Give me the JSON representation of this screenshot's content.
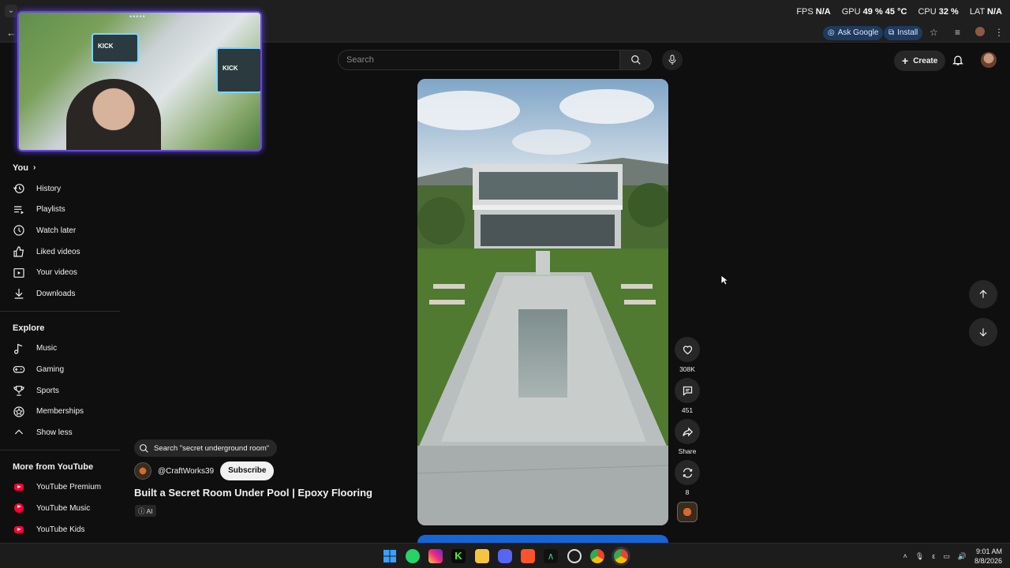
{
  "browser": {
    "stats": {
      "fps_label": "FPS",
      "fps_value": "N/A",
      "gpu_label": "GPU",
      "gpu_value": "49 %",
      "temp_value": "45 °C",
      "cpu_label": "CPU",
      "cpu_value": "32 %",
      "lat_label": "LAT",
      "lat_value": "N/A"
    },
    "ask_google": "Ask Google",
    "install": "Install"
  },
  "header": {
    "search_placeholder": "Search",
    "create_label": "Create"
  },
  "sidebar": {
    "you_title": "You",
    "you_items": [
      {
        "label": "History",
        "icon": "history-icon"
      },
      {
        "label": "Playlists",
        "icon": "playlists-icon"
      },
      {
        "label": "Watch later",
        "icon": "watch-later-icon"
      },
      {
        "label": "Liked videos",
        "icon": "like-icon"
      },
      {
        "label": "Your videos",
        "icon": "your-videos-icon"
      },
      {
        "label": "Downloads",
        "icon": "download-icon"
      }
    ],
    "explore_title": "Explore",
    "explore_items": [
      {
        "label": "Music",
        "icon": "music-note-icon"
      },
      {
        "label": "Gaming",
        "icon": "gaming-icon"
      },
      {
        "label": "Sports",
        "icon": "trophy-icon"
      },
      {
        "label": "Memberships",
        "icon": "memberships-icon"
      },
      {
        "label": "Show less",
        "icon": "chevron-up-icon"
      }
    ],
    "more_title": "More from YouTube",
    "more_items": [
      {
        "label": "YouTube Premium"
      },
      {
        "label": "YouTube Music"
      },
      {
        "label": "YouTube Kids"
      }
    ]
  },
  "short": {
    "search_chip": "Search \"secret underground room\"",
    "channel": "@CraftWorks39",
    "subscribe": "Subscribe",
    "title": "Built a Secret Room Under Pool | Epoxy Flooring",
    "ai_badge": "AI",
    "likes": "308K",
    "comments": "451",
    "share": "Share",
    "remix": "8"
  },
  "webcam": {
    "sign": "KICK"
  },
  "taskbar": {
    "time": "9:01 AM",
    "date": "8/8/2026"
  },
  "colors": {
    "background": "#0f0f0f",
    "surface": "#272727",
    "youtube_red": "#ff0033",
    "webcam_border": "#6b4bd1"
  }
}
